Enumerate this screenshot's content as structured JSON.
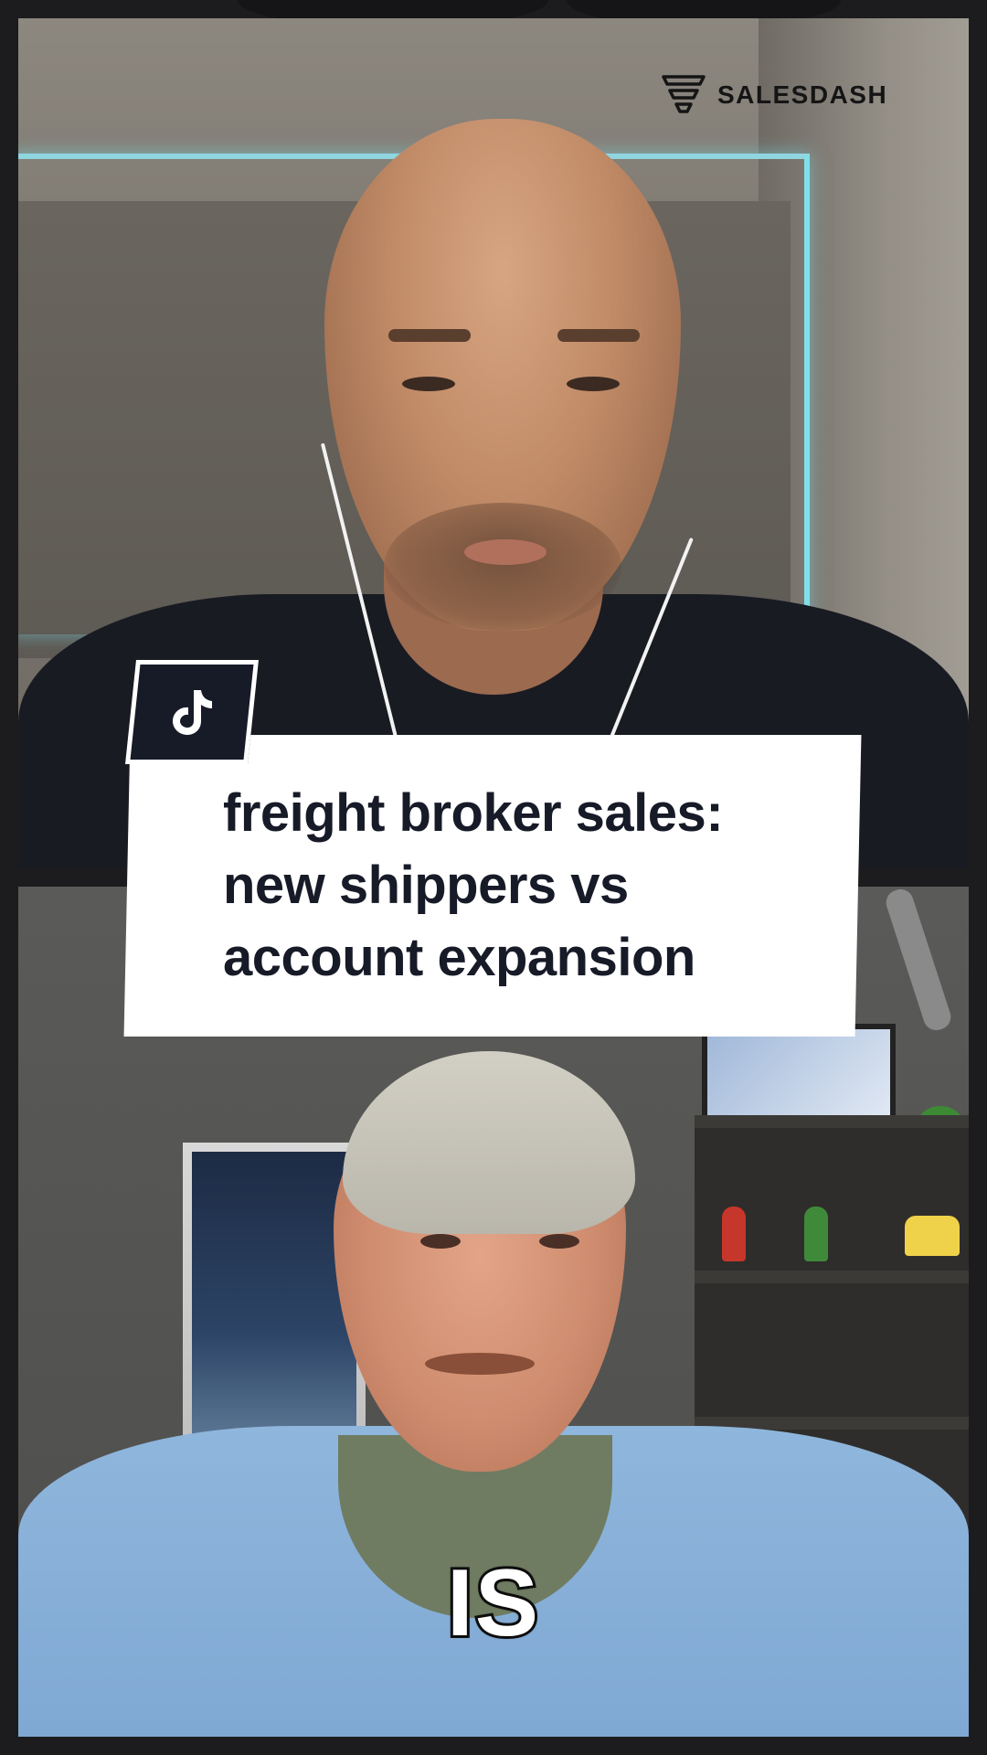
{
  "brand": {
    "name": "SALESDASH",
    "logo_icon": "funnel-icon"
  },
  "title_card": {
    "icon": "tiktok-icon",
    "lines": [
      "freight broker sales:",
      "new shippers vs",
      "account expansion"
    ]
  },
  "caption": {
    "text": "IS"
  },
  "colors": {
    "frame_bg": "#1c1c1e",
    "title_text": "#171a27",
    "title_card_bg": "#ffffff",
    "badge_bg": "#171a27",
    "caption_fill": "#ffffff",
    "caption_stroke": "#111111",
    "led_glow": "#7fe0ea"
  }
}
